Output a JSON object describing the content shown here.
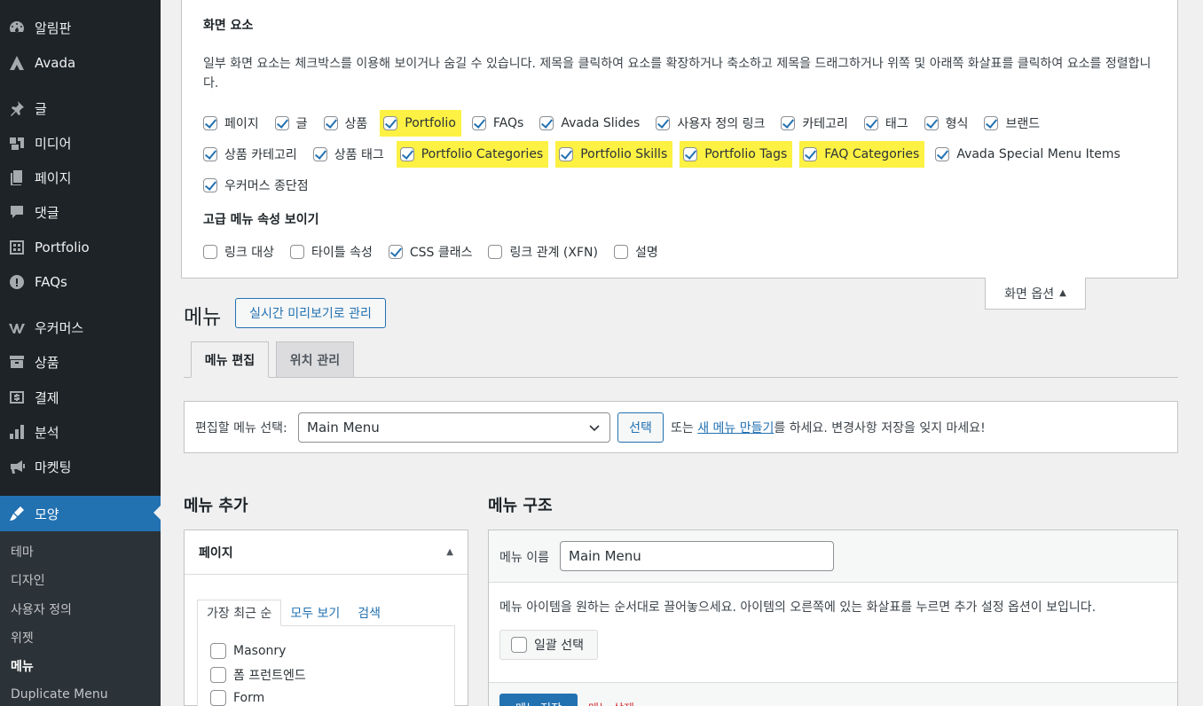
{
  "sidebar": {
    "items": [
      {
        "label": "알림판",
        "icon": "dashboard-icon"
      },
      {
        "label": "Avada",
        "icon": "avada-icon"
      },
      {
        "label": "글",
        "icon": "pin-icon"
      },
      {
        "label": "미디어",
        "icon": "media-icon"
      },
      {
        "label": "페이지",
        "icon": "page-icon"
      },
      {
        "label": "댓글",
        "icon": "comment-icon"
      },
      {
        "label": "Portfolio",
        "icon": "portfolio-icon"
      },
      {
        "label": "FAQs",
        "icon": "info-icon"
      },
      {
        "label": "우커머스",
        "icon": "woocommerce-icon"
      },
      {
        "label": "상품",
        "icon": "archive-icon"
      },
      {
        "label": "결제",
        "icon": "payment-icon"
      },
      {
        "label": "분석",
        "icon": "chart-icon"
      },
      {
        "label": "마켓팅",
        "icon": "megaphone-icon"
      },
      {
        "label": "모양",
        "icon": "brush-icon"
      }
    ],
    "submenu": [
      "테마",
      "디자인",
      "사용자 정의",
      "위젯",
      "메뉴",
      "Duplicate Menu"
    ],
    "current_sub": "메뉴"
  },
  "screen_options": {
    "title": "화면 요소",
    "description": "일부 화면 요소는 체크박스를 이용해 보이거나 숨길 수 있습니다. 제목을 클릭하여 요소를 확장하거나 축소하고 제목을 드래그하거나 위쪽 및 아래쪽 화살표를 클릭하여 요소를 정렬합니다.",
    "row1": [
      {
        "label": "페이지",
        "checked": true,
        "highlight": false
      },
      {
        "label": "글",
        "checked": true,
        "highlight": false
      },
      {
        "label": "상품",
        "checked": true,
        "highlight": false
      },
      {
        "label": "Portfolio",
        "checked": true,
        "highlight": true
      },
      {
        "label": "FAQs",
        "checked": true,
        "highlight": false
      },
      {
        "label": "Avada Slides",
        "checked": true,
        "highlight": false
      },
      {
        "label": "사용자 정의 링크",
        "checked": true,
        "highlight": false
      },
      {
        "label": "카테고리",
        "checked": true,
        "highlight": false
      },
      {
        "label": "태그",
        "checked": true,
        "highlight": false
      },
      {
        "label": "형식",
        "checked": true,
        "highlight": false
      },
      {
        "label": "브랜드",
        "checked": true,
        "highlight": false
      }
    ],
    "row2": [
      {
        "label": "상품 카테고리",
        "checked": true,
        "highlight": false
      },
      {
        "label": "상품 태그",
        "checked": true,
        "highlight": false
      },
      {
        "label": "Portfolio Categories",
        "checked": true,
        "highlight": true
      },
      {
        "label": "Portfolio Skills",
        "checked": true,
        "highlight": true
      },
      {
        "label": "Portfolio Tags",
        "checked": true,
        "highlight": true
      },
      {
        "label": "FAQ Categories",
        "checked": true,
        "highlight": true
      },
      {
        "label": "Avada Special Menu Items",
        "checked": true,
        "highlight": false
      }
    ],
    "row3": [
      {
        "label": "우커머스 종단점",
        "checked": true,
        "highlight": false
      }
    ],
    "advanced_title": "고급 메뉴 속성 보이기",
    "advanced": [
      {
        "label": "링크 대상",
        "checked": false
      },
      {
        "label": "타이틀 속성",
        "checked": false
      },
      {
        "label": "CSS 클래스",
        "checked": true
      },
      {
        "label": "링크 관계 (XFN)",
        "checked": false
      },
      {
        "label": "설명",
        "checked": false
      }
    ],
    "tab_label": "화면 옵션",
    "highlight_color": "#fdf143"
  },
  "header": {
    "title": "메뉴",
    "preview_button": "실시간 미리보기로 관리"
  },
  "tabs": [
    {
      "label": "메뉴 편집",
      "active": true
    },
    {
      "label": "위치 관리",
      "active": false
    }
  ],
  "select_bar": {
    "label": "편집할 메뉴 선택:",
    "selected": "Main Menu",
    "button": "선택",
    "text_before": "또는 ",
    "link": "새 메뉴 만들기",
    "text_after": "를 하세요. 변경사항 저장을 잊지 마세요!"
  },
  "add_items": {
    "heading": "메뉴 추가",
    "panel_title": "페이지",
    "tabs": [
      "가장 최근 순",
      "모두 보기",
      "검색"
    ],
    "items": [
      "Masonry",
      "폼 프런트엔드",
      "Form"
    ]
  },
  "structure": {
    "heading": "메뉴 구조",
    "name_label": "메뉴 이름",
    "name_value": "Main Menu",
    "description": "메뉴 아이템을 원하는 순서대로 끌어놓으세요. 아이템의 오른쪽에 있는 화살표를 누르면 추가 설정 옵션이 보입니다.",
    "bulk_select": "일괄 선택",
    "save_button": "메뉴 저장",
    "delete_link": "메뉴 삭제"
  },
  "colors": {
    "accent": "#2271b1",
    "sidebar": "#1d2327"
  }
}
